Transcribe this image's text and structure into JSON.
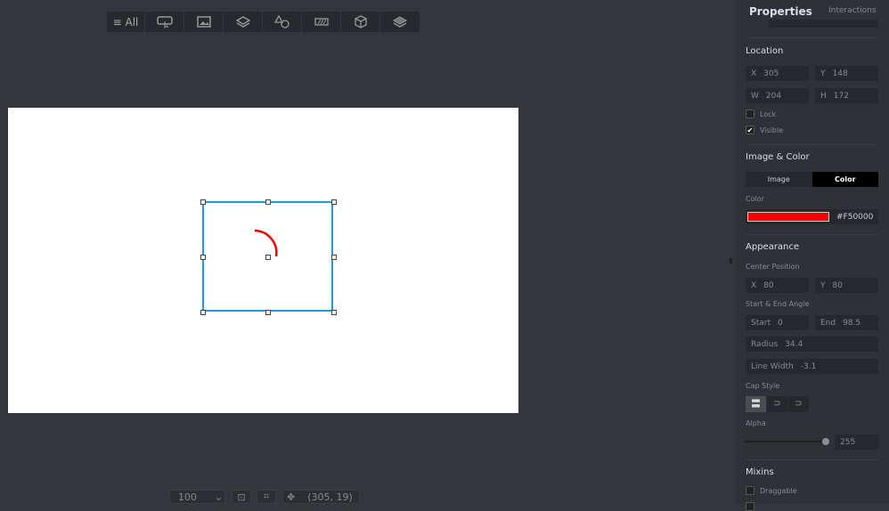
{
  "toolbar": {
    "all_label": "≡ All",
    "icons": [
      "interaction-icon",
      "image-icon",
      "layers-icon",
      "shapes-icon",
      "slider-icon",
      "cube-icon",
      "stack-icon"
    ]
  },
  "selection": {
    "arc_color": "#F50000"
  },
  "bottom": {
    "zoom": "100",
    "coords": "(305, 19)"
  },
  "panel": {
    "tab_properties": "Properties",
    "tab_interactions": "Interactions",
    "location": {
      "title": "Location",
      "x_label": "X",
      "x": "305",
      "y_label": "Y",
      "y": "148",
      "w_label": "W",
      "w": "204",
      "h_label": "H",
      "h": "172",
      "lock": "Lock",
      "visible": "Visible",
      "lock_checked": false,
      "visible_checked": true
    },
    "image_color": {
      "title": "Image & Color",
      "tab_image": "Image",
      "tab_color": "Color",
      "color_label": "Color",
      "color_hex": "#F50000",
      "swatch": "#F50000"
    },
    "appearance": {
      "title": "Appearance",
      "center_label": "Center Position",
      "cx_label": "X",
      "cx": "80",
      "cy_label": "Y",
      "cy": "80",
      "angle_label": "Start & End Angle",
      "start_label": "Start",
      "start": "0",
      "end_label": "End",
      "end": "98.5",
      "radius_label": "Radius",
      "radius": "34.4",
      "linewidth_label": "Line Width",
      "linewidth": "-3.1",
      "cap_label": "Cap Style",
      "alpha_label": "Alpha",
      "alpha": "255"
    },
    "mixins": {
      "title": "Mixins",
      "draggable": "Draggable"
    }
  }
}
